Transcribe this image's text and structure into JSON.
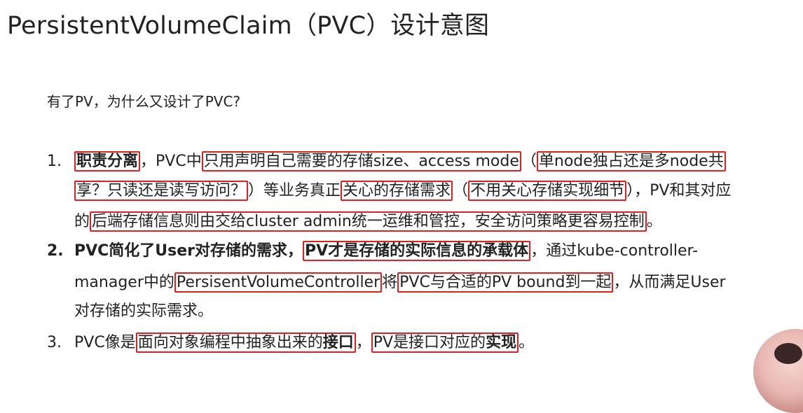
{
  "title": "PersistentVolumeClaim（PVC）设计意图",
  "question": "有了PV，为什么又设计了PVC?",
  "items": [
    {
      "number": "1.",
      "lines": [
        [
          "职责分离",
          "，PVC中",
          "只用声明自己需要的存储size、access mode",
          "（",
          "单node独占还是多node共"
        ],
        [
          "享？只读还是读写访问？",
          "）等业务真正",
          "关心的存储需求",
          "（",
          "不用关心存储实现细节",
          "），PV和其对应"
        ],
        [
          "的",
          "后端存储信息则由交给cluster admin统一运维和管控，安全访问策略更容易控制",
          "。"
        ]
      ]
    },
    {
      "number": "2.",
      "lines": [
        [
          "PVC简化了User对存储的需求，",
          "PV才是存储的实际信息的承载体",
          "，通过kube-controller-"
        ],
        [
          "manager中的",
          "PersisentVolumeController",
          "将",
          "PVC与合适的PV bound到一起",
          "，从而满足User"
        ],
        [
          "对存储的实际需求。"
        ]
      ]
    },
    {
      "number": "3.",
      "lines": [
        [
          "PVC像是",
          "面向对象编程中抽象出来的",
          "接口",
          "，",
          "PV是接口对应的",
          "实现",
          "。"
        ]
      ]
    }
  ]
}
